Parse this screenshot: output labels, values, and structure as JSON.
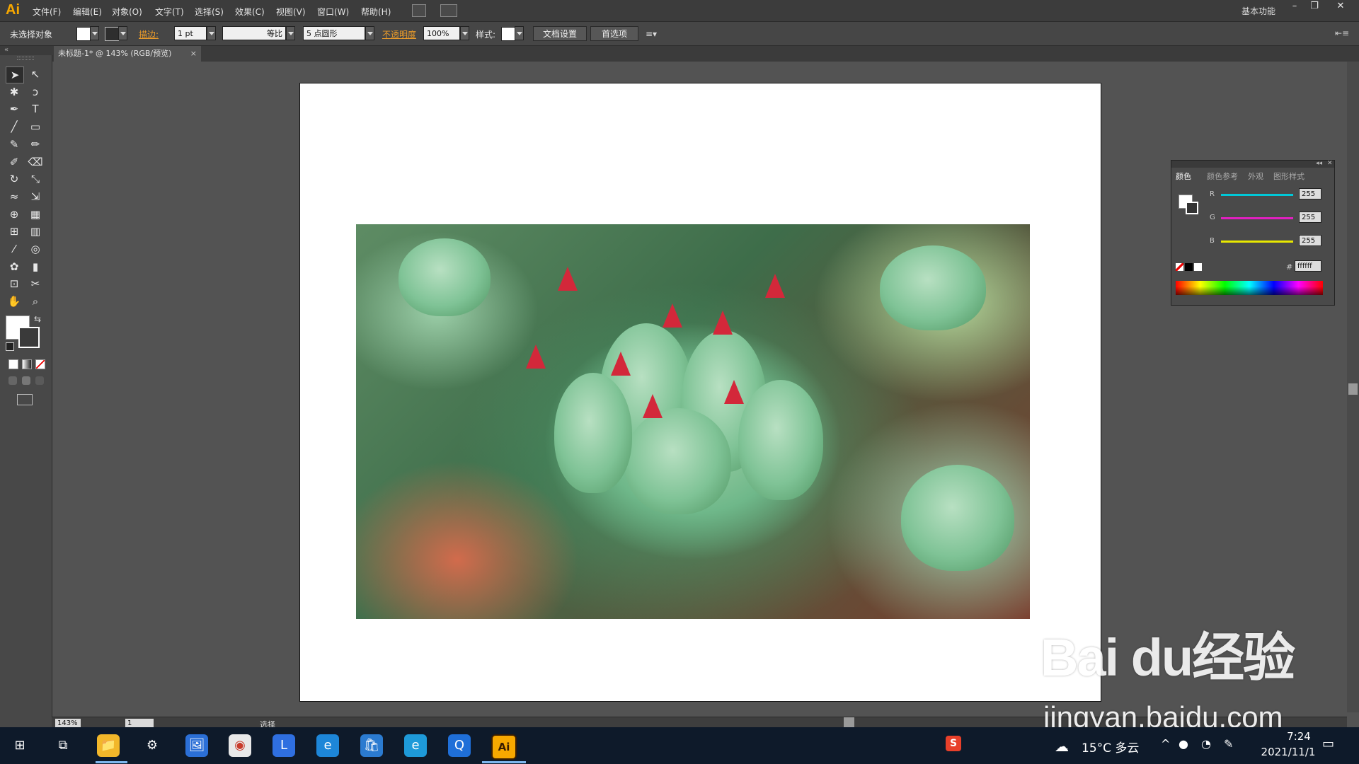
{
  "app": {
    "logo": "Ai",
    "menus": [
      "文件(F)",
      "编辑(E)",
      "对象(O)",
      "文字(T)",
      "选择(S)",
      "效果(C)",
      "视图(V)",
      "窗口(W)",
      "帮助(H)"
    ],
    "workspace": "基本功能",
    "window_buttons": [
      "–",
      "❐",
      "✕"
    ]
  },
  "control_bar": {
    "selection_status": "未选择对象",
    "stroke_label": "描边:",
    "stroke_weight": "1 pt",
    "stroke_profile": "等比",
    "brush": "5 点圆形",
    "opacity_label": "不透明度",
    "opacity": "100%",
    "style_label": "样式:",
    "doc_setup_btn": "文档设置",
    "prefs_btn": "首选项"
  },
  "document_tab": {
    "title": "未标题-1* @ 143% (RGB/预览)",
    "close": "×"
  },
  "tools": {
    "icons": [
      "selection-icon",
      "direct-selection-icon",
      "magic-wand-icon",
      "lasso-icon",
      "pen-icon",
      "type-icon",
      "line-icon",
      "rectangle-icon",
      "paintbrush-icon",
      "pencil-icon",
      "blob-brush-icon",
      "eraser-icon",
      "rotate-icon",
      "scale-icon",
      "warp-icon",
      "free-transform-icon",
      "shape-builder-icon",
      "perspective-icon",
      "mesh-icon",
      "gradient-icon",
      "eyedropper-icon",
      "blend-icon",
      "symbol-sprayer-icon",
      "graph-icon",
      "artboard-icon",
      "slice-icon",
      "hand-icon",
      "zoom-icon"
    ],
    "glyphs": [
      "➤",
      "↖",
      "✱",
      "ↄ",
      "✒",
      "T",
      "╱",
      "▭",
      "✎",
      "✏",
      "✐",
      "⌫",
      "↻",
      "⤡",
      "≈",
      "⇲",
      "⊕",
      "▦",
      "⊞",
      "▥",
      "⁄",
      "◎",
      "✿",
      "▮",
      "⊡",
      "✂",
      "✋",
      "⌕"
    ]
  },
  "statusbar": {
    "zoom": "143%",
    "page": "1",
    "status": "选择"
  },
  "color_panel": {
    "tabs": [
      "颜色",
      "颜色参考",
      "外观",
      "图形样式"
    ],
    "channels": [
      {
        "label": "R",
        "value": "255",
        "color": "#00c8d8"
      },
      {
        "label": "G",
        "value": "255",
        "color": "#e020c0"
      },
      {
        "label": "B",
        "value": "255",
        "color": "#e8e800"
      }
    ],
    "hex_label": "#",
    "hex": "ffffff"
  },
  "watermark": {
    "brand": "Bai du经验",
    "url": "jingyan.baidu.com"
  },
  "taskbar": {
    "icons": [
      "windows-start-icon",
      "task-view-icon",
      "file-explorer-icon",
      "settings-icon",
      "photos-icon",
      "chrome-icon",
      "l-app-icon",
      "ie-icon",
      "store-icon",
      "edge-icon",
      "browser-q-icon",
      "illustrator-icon"
    ],
    "glyphs": [
      "⊞",
      "⧉",
      "📁",
      "⚙",
      "🖼",
      "◉",
      "L",
      "e",
      "🛍",
      "e",
      "Q",
      "Ai"
    ],
    "weather": "15°C 多云",
    "time": "7:24",
    "date": "2021/11/1"
  },
  "colors": {
    "accent": "#f7a800",
    "orange_label": "#e99b2a"
  }
}
